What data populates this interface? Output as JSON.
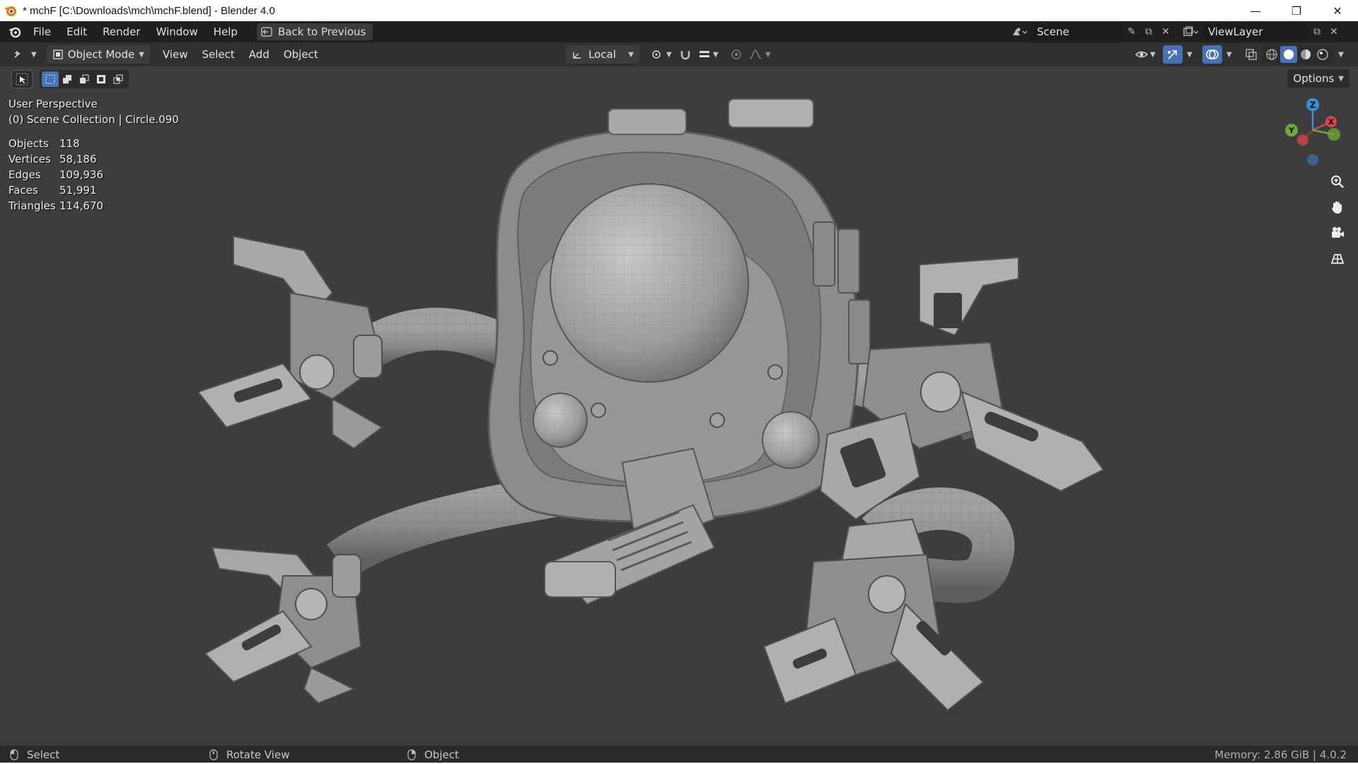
{
  "window": {
    "title": "* mchF [C:\\Downloads\\mch\\mchF.blend] - Blender 4.0",
    "minimize": "—",
    "restore": "❐",
    "close": "✕"
  },
  "menubar": {
    "items": [
      "File",
      "Edit",
      "Render",
      "Window",
      "Help"
    ],
    "back_button": "Back to Previous",
    "scene": "Scene",
    "view_layer": "ViewLayer"
  },
  "viewport_header": {
    "mode": "Object Mode",
    "menus": [
      "View",
      "Select",
      "Add",
      "Object"
    ],
    "transform_orientation": "Local",
    "options": "Options"
  },
  "viewport": {
    "perspective": "User Perspective",
    "collection": "(0) Scene Collection | Circle.090",
    "stats": [
      {
        "label": "Objects",
        "value": "118"
      },
      {
        "label": "Vertices",
        "value": "58,186"
      },
      {
        "label": "Edges",
        "value": "109,936"
      },
      {
        "label": "Faces",
        "value": "51,991"
      },
      {
        "label": "Triangles",
        "value": "114,670"
      }
    ],
    "gizmo_axes": {
      "z": "Z",
      "y": "Y",
      "x": "X"
    }
  },
  "statusbar": {
    "left_click": "Select",
    "middle_click": "Rotate View",
    "right_click": "Object",
    "memory": "Memory: 2.86 GiB | 4.0.2"
  },
  "colors": {
    "accent": "#4772b3",
    "viewport_bg": "#3d3d3d",
    "x_axis": "#d9444f",
    "y_axis": "#6fa935",
    "z_axis": "#3b8fd9"
  }
}
